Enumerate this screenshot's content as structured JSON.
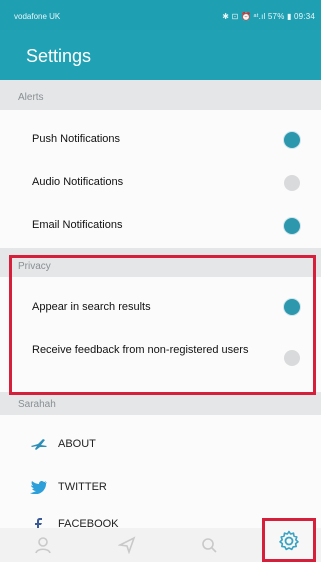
{
  "status": {
    "carrier": "vodafone UK",
    "indicators": "✱ ⊡ ⏰ ᵃᵗ.ıl 57% ▮ 09:34"
  },
  "header": {
    "title": "Settings"
  },
  "sections": {
    "alerts": {
      "label": "Alerts",
      "items": [
        {
          "label": "Push Notifications",
          "enabled": true
        },
        {
          "label": "Audio Notifications",
          "enabled": false
        },
        {
          "label": "Email Notifications",
          "enabled": true
        }
      ]
    },
    "privacy": {
      "label": "Privacy",
      "items": [
        {
          "label": "Appear in search results",
          "enabled": true
        },
        {
          "label": "Receive feedback from non-registered users",
          "enabled": false
        }
      ]
    },
    "sarahah": {
      "label": "Sarahah",
      "links": [
        {
          "label": "ABOUT",
          "icon": "plane-icon"
        },
        {
          "label": "TWITTER",
          "icon": "twitter-icon"
        },
        {
          "label": "FACEBOOK",
          "icon": "facebook-icon"
        }
      ]
    }
  },
  "bottom_nav": {
    "icons": [
      "profile-icon",
      "send-icon",
      "search-icon",
      "settings-gear-icon"
    ],
    "selected": "settings-gear-icon"
  },
  "colors": {
    "accent": "#21a1b4",
    "toggle_on": "#2c97ad",
    "highlight_box": "#d61f3b"
  }
}
